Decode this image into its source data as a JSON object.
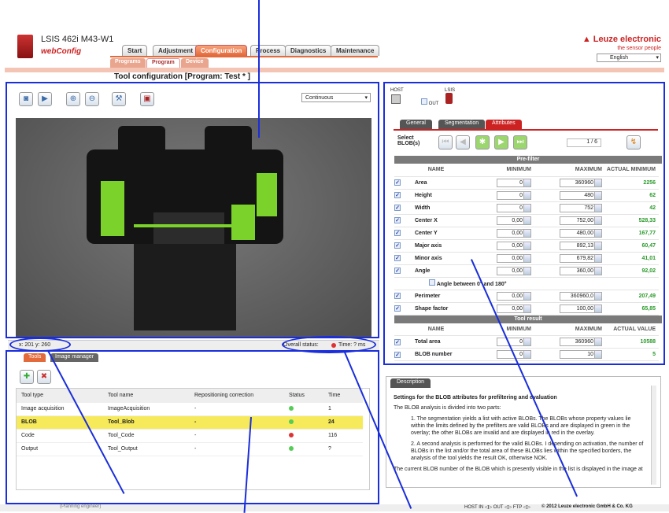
{
  "app": {
    "title": "LSIS 462i M43-W1",
    "subtitle": "webConfig",
    "brand": "Leuze electronic",
    "tagline": "the sensor people",
    "language": "English"
  },
  "main_tabs": [
    "Start",
    "Adjustment",
    "Configuration",
    "Process",
    "Diagnostics",
    "Maintenance"
  ],
  "sub_tabs": [
    "Programs",
    "Program",
    "Device"
  ],
  "page_title": "Tool configuration   [Program: Test * ]",
  "toolbar": {
    "mode": "Continuous"
  },
  "status": {
    "coords": "x: 201 y: 260",
    "overall": "Overall status:",
    "time": "Time: ? ms"
  },
  "tools_tabs": [
    "Tools",
    "Image manager"
  ],
  "tools_table": {
    "headers": [
      "Tool type",
      "Tool name",
      "Repositioning correction",
      "Status",
      "Time"
    ],
    "rows": [
      {
        "type": "Image acquisition",
        "name": "ImageAcquisition",
        "rep": "-",
        "status": "green",
        "time": "1"
      },
      {
        "type": "BLOB",
        "name": "Tool_Blob",
        "rep": "-",
        "status": "green",
        "time": "24"
      },
      {
        "type": "Code",
        "name": "Tool_Code",
        "rep": "-",
        "status": "red",
        "time": "116"
      },
      {
        "type": "Output",
        "name": "Tool_Output",
        "rep": "-",
        "status": "green",
        "time": "?"
      }
    ]
  },
  "host": {
    "host": "HOST",
    "lsis": "LSIS",
    "out": "OUT"
  },
  "attr_tabs": [
    "General",
    "Segmentation",
    "Attributes"
  ],
  "select_blob": {
    "label": "Select BLOB(s)",
    "counter": "1 / 6"
  },
  "prefilter": {
    "title": "Pre-filter",
    "nominal": "NOMINAL",
    "h_name": "NAME",
    "h_min": "MINIMUM",
    "h_max": "MAXIMUM",
    "h_actual": "ACTUAL MINIMUM",
    "rows": [
      {
        "name": "Area",
        "min": "0",
        "max": "360960",
        "actual": "2256"
      },
      {
        "name": "Height",
        "min": "0",
        "max": "480",
        "actual": "62"
      },
      {
        "name": "Width",
        "min": "0",
        "max": "752",
        "actual": "42"
      },
      {
        "name": "Center X",
        "min": "0,00",
        "max": "752,00",
        "actual": "528,33"
      },
      {
        "name": "Center Y",
        "min": "0,00",
        "max": "480,00",
        "actual": "167,77"
      },
      {
        "name": "Major axis",
        "min": "0,00",
        "max": "892,13",
        "actual": "60,47"
      },
      {
        "name": "Minor axis",
        "min": "0,00",
        "max": "679,82",
        "actual": "41,01"
      },
      {
        "name": "Angle",
        "min": "0,00",
        "max": "360,00",
        "actual": "92,02"
      }
    ],
    "angle_opt": "Angle between 0° and 180°",
    "rows2": [
      {
        "name": "Perimeter",
        "min": "0,00",
        "max": "360960,0",
        "actual": "207,49"
      },
      {
        "name": "Shape factor",
        "min": "0,00",
        "max": "100,00",
        "actual": "65,85"
      }
    ]
  },
  "toolresult": {
    "title": "Tool result",
    "nominal": "NOMINAL",
    "h_name": "NAME",
    "h_min": "MINIMUM",
    "h_max": "MAXIMUM",
    "h_actual": "ACTUAL VALUE",
    "rows": [
      {
        "name": "Total area",
        "min": "0",
        "max": "360960",
        "actual": "10588"
      },
      {
        "name": "BLOB number",
        "min": "0",
        "max": "10",
        "actual": "5"
      }
    ]
  },
  "description": {
    "tab": "Description",
    "heading": "Settings for the BLOB attributes for prefiltering and evaluation",
    "intro": "The BLOB analysis is divided into two parts:",
    "p1": "The segmentation yields a list with active BLOBs. The BLOBs whose property values lie within the limits defined by the prefilters are valid BLOBs and are displayed in green in the overlay; the other BLOBs are invalid and are displayed in red in the overlay.",
    "p2": "A second analysis is performed for the valid BLOBs. I depending on activation, the number of BLOBs in the list and/or the total area of these BLOBs lies within the specified borders, the analysis of the tool yields the result OK, otherwise NOK.",
    "p3": "The current BLOB number of the BLOB which is presently visible in the list is displayed in the image at the position of the centroid."
  },
  "footer": {
    "role": "(Planning engineer)",
    "io": "HOST IN ◁▷ OUT ◁▷ FTP ◁▷",
    "copyright": "© 2012 Leuze electronic GmbH & Co. KG"
  }
}
